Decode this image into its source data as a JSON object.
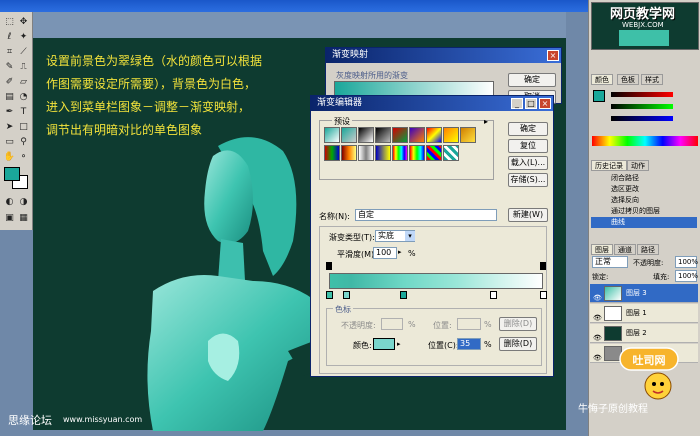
{
  "instructions": [
    "设置前景色为翠绿色（水的颜色可以根据",
    "作图需要设定所需要），背景色为白色，",
    "进入到菜单栏图象－调整－渐变映射，",
    "调节出有明暗对比的单色图象"
  ],
  "gradient_map_dialog": {
    "title": "渐变映射",
    "section": "灰度映射所用的渐变",
    "ok": "确定",
    "cancel": "取消"
  },
  "gradient_editor": {
    "title": "渐变编辑器",
    "presets_label": "预设",
    "ok": "确定",
    "reset": "复位",
    "load": "载入(L)...",
    "save": "存储(S)...",
    "name_label": "名称(N):",
    "name_value": "自定",
    "new_button": "新建(W)",
    "type_label": "渐变类型(T):",
    "type_value": "实底",
    "smooth_label": "平滑度(M):",
    "smooth_value": "100",
    "smooth_unit": "%",
    "stops_section": "色标",
    "opacity_label": "不透明度:",
    "opacity_unit": "%",
    "location_label": "位置:",
    "delete_label": "删除(D)",
    "color_label": "颜色:",
    "color_value": "#7ad6cc",
    "location2_label": "位置(C):",
    "location2_value": "35",
    "location2_unit": "%",
    "delete2_label": "删除(D)"
  },
  "right_panel": {
    "color_tabs": [
      "颜色",
      "色板",
      "样式"
    ],
    "history_tabs": [
      "历史记录",
      "动作"
    ],
    "history_items": [
      "闭合路径",
      "选区更改",
      "选择反向",
      "通过拷贝的图层",
      "曲线"
    ],
    "layer_tabs": [
      "图层",
      "通道",
      "路径"
    ],
    "blend_mode": "正常",
    "opacity_label": "不透明度:",
    "opacity_value": "100%",
    "lock_label": "锁定:",
    "fill_label": "填充:",
    "fill_value": "100%",
    "layers": [
      "图层 3",
      "图层 1",
      "图层 2",
      "背景"
    ]
  },
  "watermarks": {
    "top_right": "网页教学网",
    "top_right_url": "WEBJX.COM",
    "bottom_left": "思缘论坛",
    "bottom_left_url": "www.missyuan.com",
    "bottom_right": "牛悔子原创教程",
    "logo_text": "吐司网"
  }
}
